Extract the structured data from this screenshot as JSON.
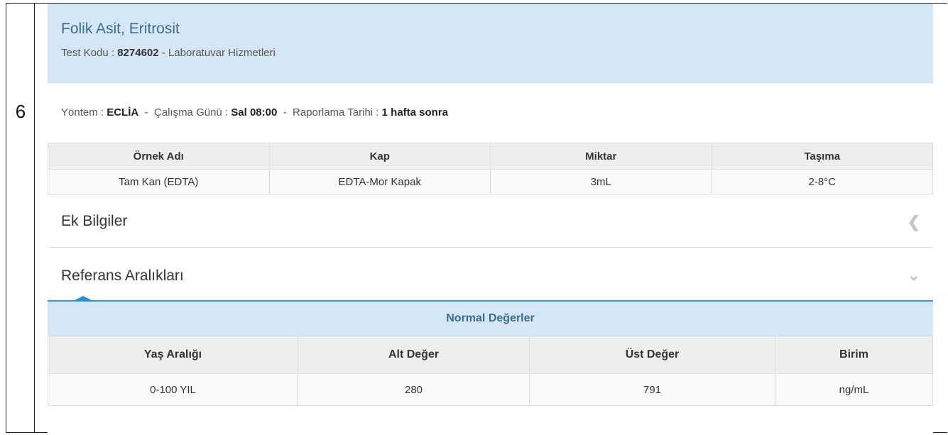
{
  "row_number": "6",
  "test": {
    "name": "Folik Asit, Eritrosit",
    "code_label": "Test Kodu :",
    "code": "8274602",
    "department": "- Laboratuvar Hizmetleri"
  },
  "meta": {
    "method_label": "Yöntem :",
    "method": "ECLİA",
    "sep1": "-",
    "workday_label": "Çalışma Günü :",
    "workday": "Sal 08:00",
    "sep2": "-",
    "report_label": "Raporlama Tarihi :",
    "report": "1 hafta sonra"
  },
  "sample_table": {
    "headers": [
      "Örnek Adı",
      "Kap",
      "Miktar",
      "Taşıma"
    ],
    "row": [
      "Tam Kan (EDTA)",
      "EDTA-Mor Kapak",
      "3mL",
      "2-8°C"
    ]
  },
  "accordion": {
    "extra_info": "Ek Bilgiler",
    "extra_info_icon": "chevron-left-icon",
    "reference": "Referans Aralıkları",
    "reference_icon": "chevron-down-icon"
  },
  "reference_table": {
    "caption": "Normal Değerler",
    "headers": [
      "Yaş Aralığı",
      "Alt Değer",
      "Üst Değer",
      "Birim"
    ],
    "row": [
      "0-100 YIL",
      "280",
      "791",
      "ng/mL"
    ]
  }
}
